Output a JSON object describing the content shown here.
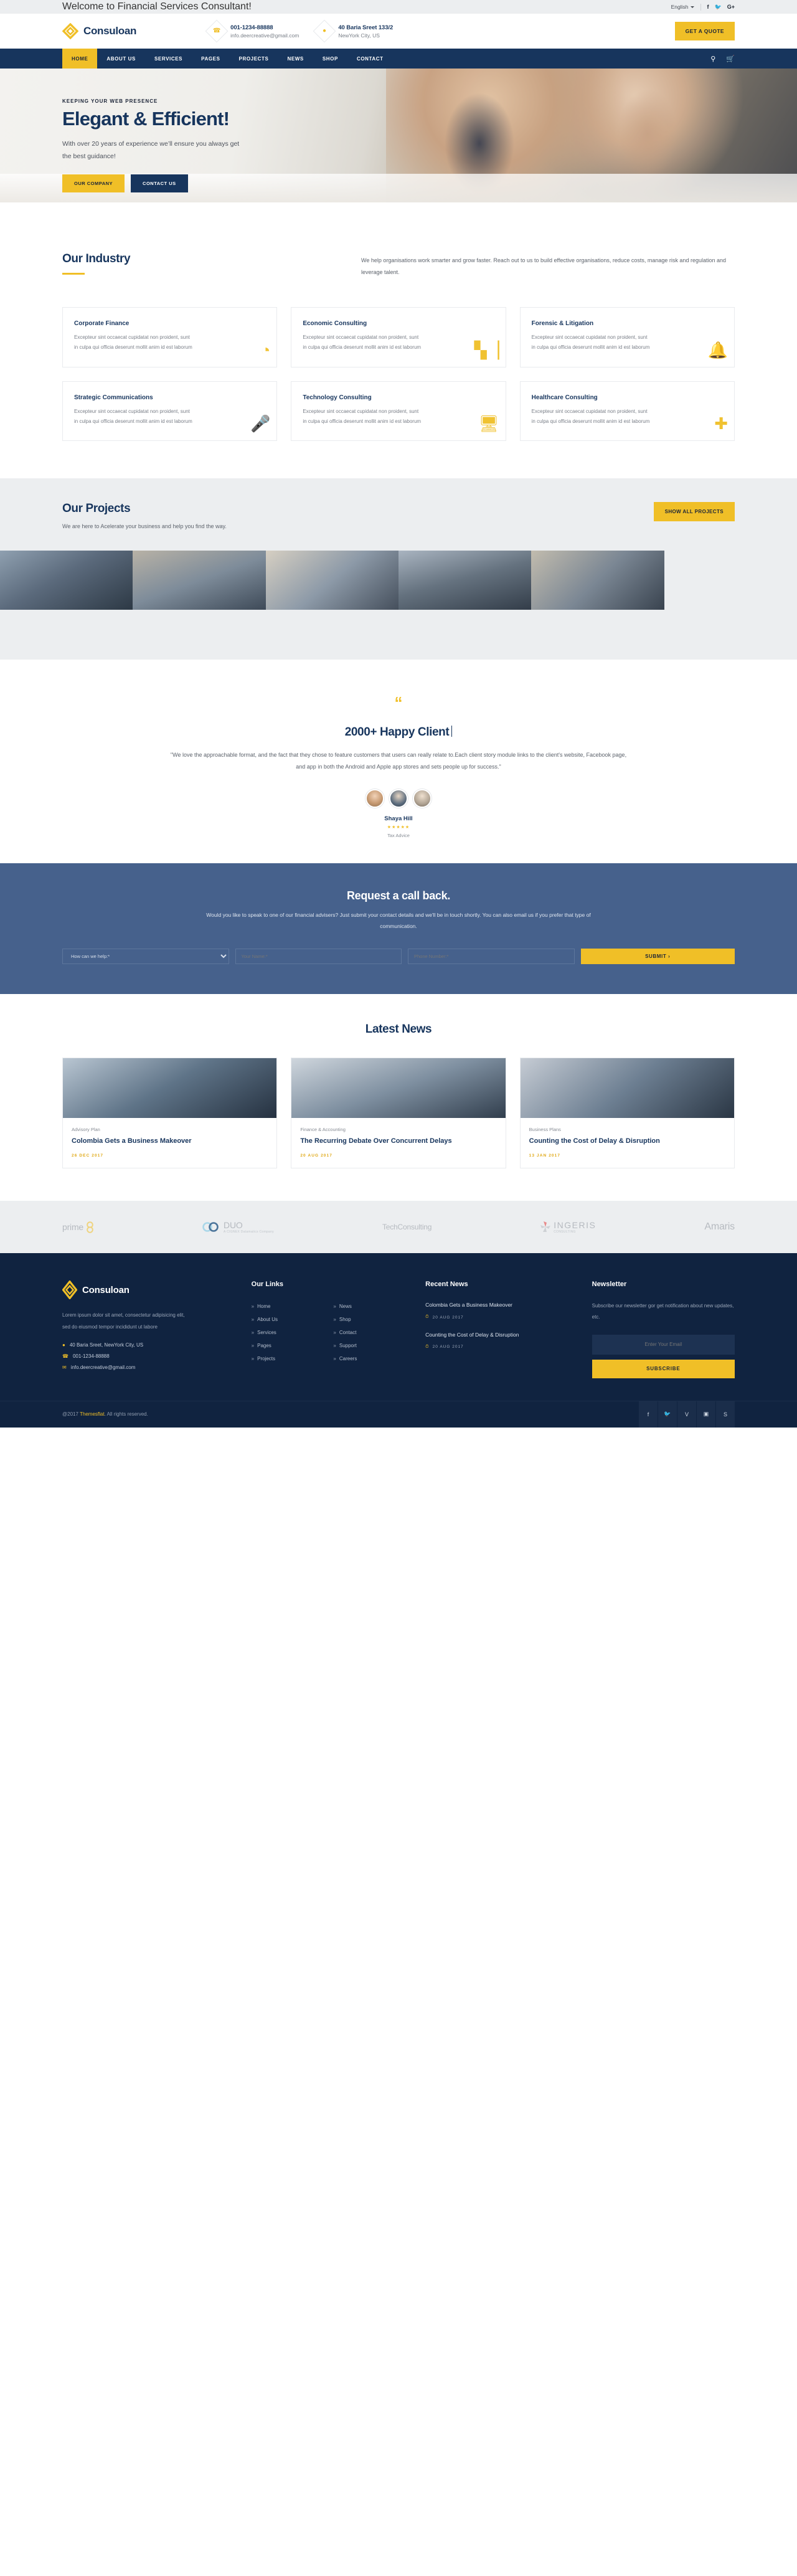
{
  "topbar": {
    "welcome": "Welcome to Financial Services Consultant!",
    "language": "English",
    "social": [
      "f",
      "𝐅",
      "G+"
    ],
    "social_names": [
      "facebook-icon",
      "twitter-icon",
      "google-plus-icon"
    ]
  },
  "header": {
    "brand": "Consuloan",
    "phone_label": "001-1234-88888",
    "phone_sub": "info.deercreative@gmail.com",
    "address_label": "40 Baria Sreet 133/2",
    "address_sub": "NewYork City, US",
    "quote_button": "GET A QUOTE"
  },
  "nav": {
    "items": [
      "HOME",
      "ABOUT US",
      "SERVICES",
      "PAGES",
      "PROJECTS",
      "NEWS",
      "SHOP",
      "CONTACT"
    ],
    "active": "HOME",
    "search_icon": "⌕",
    "cart_icon": "🛒"
  },
  "hero": {
    "kicker": "KEEPING YOUR WEB PRESENCE",
    "title": "Elegant & Efficient!",
    "subtitle": "With over 20 years of experience we’ll ensure you always get the best guidance!",
    "btn_primary": "OUR COMPANY",
    "btn_secondary": "CONTACT US"
  },
  "industry": {
    "title": "Our Industry",
    "description": "We help organisations work smarter and grow faster. Reach out to us to build effective organisations, reduce costs, manage risk and regulation and leverage talent.",
    "body": "Excepteur sint occaecat cupidatat non proident, sunt in culpa qui officia deserunt mollit anim id est laborum",
    "cards": [
      {
        "title": "Corporate Finance",
        "icon": "◔",
        "icon_name": "pie-chart-icon"
      },
      {
        "title": "Economic Consulting",
        "icon": "📊",
        "icon_name": "bar-chart-icon"
      },
      {
        "title": "Forensic & Litigation",
        "icon": "⚠",
        "icon_name": "bell-icon"
      },
      {
        "title": "Strategic Communications",
        "icon": "🎤",
        "icon_name": "microphone-icon"
      },
      {
        "title": "Technology Consulting",
        "icon": "🖥",
        "icon_name": "monitor-icon"
      },
      {
        "title": "Healthcare Consulting",
        "icon": "✚",
        "icon_name": "medical-cross-icon"
      }
    ]
  },
  "projects": {
    "title": "Our Projects",
    "subtitle": "We are here to Acelerate your business and help you find the way.",
    "button": "SHOW ALL PROJECTS",
    "thumbs": [
      "pc1",
      "pc2",
      "pc3",
      "pc4",
      "pc5",
      "pc6"
    ]
  },
  "testimonial": {
    "quote_icon": "“",
    "title": "2000+ Happy Client",
    "text": "\"We love the approachable format, and the fact that they chose to feature customers that users can really relate to.Each client story module links to the client's website, Facebook page, and app in both the Android and Apple app stores and sets people up for success.\"",
    "name": "Shaya Hill",
    "stars": "★★★★★",
    "role": "Tax Advice"
  },
  "callback": {
    "title": "Request a call back.",
    "subtitle": "Would you like to speak to one of our financial advisers? Just submit your contact details and we'll be in touch shortly. You can also email us if you prefer that type of communication.",
    "select_value": "How can we help:*",
    "name_placeholder": "Your Name:*",
    "phone_placeholder": "Phone Number:*",
    "submit_label": "SUBMIT  ›"
  },
  "news": {
    "title": "Latest News",
    "items": [
      {
        "category": "Advisory Plan",
        "headline": "Colombia Gets a Business Makeover",
        "date": "26 DEC 2017",
        "thumb": "nt1"
      },
      {
        "category": "Finance & Accounting",
        "headline": "The Recurring Debate Over Concurrent Delays",
        "date": "20 AUG 2017",
        "thumb": "nt2"
      },
      {
        "category": "Business Plans",
        "headline": "Counting the Cost of Delay & Disruption",
        "date": "13 JAN 2017",
        "thumb": "nt3"
      }
    ]
  },
  "brands": [
    {
      "name": "prime",
      "sub": ""
    },
    {
      "name": "DUO",
      "sub": "A CIGNEX Datamatics Company"
    },
    {
      "name": "TechConsulting",
      "sub": ""
    },
    {
      "name": "INGERIS",
      "sub": "CONSULTING"
    },
    {
      "name": "Amaris",
      "sub": ""
    }
  ],
  "footer": {
    "brand": "Consuloan",
    "about": "Lorem ipsum dolor sit amet, consectetur adipisicing elit, sed do eiusmod tempor incididunt ut labore",
    "contact": [
      {
        "icon": "📍",
        "icon_name": "location-pin-icon",
        "text": "40 Baria Sreet, NewYork City, US"
      },
      {
        "icon": "☎",
        "icon_name": "phone-icon",
        "text": "001-1234-88888"
      },
      {
        "icon": "✉",
        "icon_name": "envelope-icon",
        "text": "info.deercreative@gmail.com"
      }
    ],
    "links_title": "Our Links",
    "links": [
      "Home",
      "News",
      "About Us",
      "Shop",
      "Services",
      "Contact",
      "Pages",
      "Support",
      "Projects",
      "Careers"
    ],
    "news_title": "Recent News",
    "news": [
      {
        "headline": "Colombia Gets a Business Makeover",
        "date": "20 AUG 2017"
      },
      {
        "headline": "Counting the Cost of Delay & Disruption",
        "date": "20 AUG 2017"
      }
    ],
    "newsletter_title": "Newsletter",
    "newsletter_desc": "Subscribe our newsletter gor get notification about new updates, etc.",
    "email_placeholder": "Enter Your Email",
    "subscribe_label": "SUBSCRIBE",
    "copyright_pre": "@2017 ",
    "copyright_brand": "Themesflat",
    "copyright_post": ". All rights reserved.",
    "social": [
      "f",
      "t",
      "v",
      "▣",
      "S"
    ],
    "social_names": [
      "facebook-icon",
      "twitter-icon",
      "vimeo-icon",
      "instagram-icon",
      "skype-icon"
    ]
  },
  "colors": {
    "accent": "#f0bf27",
    "navy": "#17355d",
    "footer_bg": "#102340",
    "callback_bg": "#46618c"
  }
}
